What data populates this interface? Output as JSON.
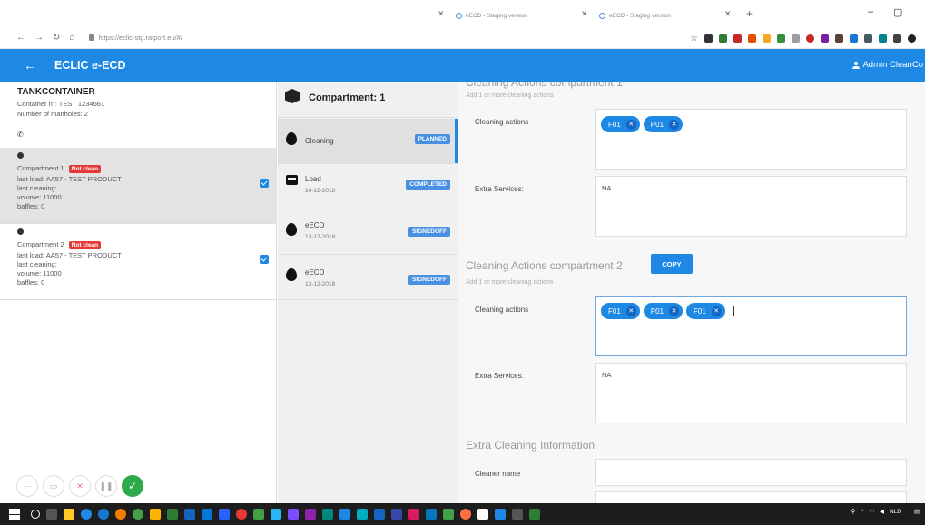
{
  "browser": {
    "tabs": [
      {
        "label": "eECD - Staging version"
      },
      {
        "label": "eECD - Staging version"
      }
    ],
    "url": "https://eclic-stg.ratport.eu/#/"
  },
  "appbar": {
    "title": "ECLIC e-ECD",
    "user": "Admin CleanCo"
  },
  "tank": {
    "title": "TANKCONTAINER",
    "container": "Container n°: TEST 1234561",
    "manholes": "Number of manholes: 2"
  },
  "compartments": [
    {
      "name": "Compartment 1",
      "badge": "Not clean",
      "last_load": "last load: AA57 - TEST PRODUCT",
      "last_cleaning": "last cleaning:",
      "volume": "volume: 11000",
      "baffles": "baffles: 0"
    },
    {
      "name": "Compartment 2",
      "badge": "Not clean",
      "last_load": "last load: AA57 - TEST PRODUCT",
      "last_cleaning": "last cleaning:",
      "volume": "volume: 11000",
      "baffles": "baffles: 0"
    }
  ],
  "middle": {
    "title": "Compartment: 1",
    "steps": [
      {
        "name": "Cleaning",
        "date": "",
        "status": "PLANNED"
      },
      {
        "name": "Load",
        "date": "10-12-2018",
        "status": "COMPLETED"
      },
      {
        "name": "eECD",
        "date": "13-12-2018",
        "status": "SIGNEDOFF"
      },
      {
        "name": "eECD",
        "date": "13-12-2018",
        "status": "SIGNEDOFF"
      }
    ]
  },
  "form": {
    "sec1": {
      "title": "Cleaning Actions compartment 1",
      "subtitle": "Add 1 or more cleaning actions",
      "actions_label": "Cleaning actions",
      "chips": [
        "F01",
        "P01"
      ],
      "services_label": "Extra Services:",
      "services_value": "NA"
    },
    "sec2": {
      "title": "Cleaning Actions compartment 2",
      "copy_label": "COPY",
      "subtitle": "Add 1 or more cleaning actions",
      "actions_label": "Cleaning actions",
      "chips": [
        "F01",
        "P01",
        "F01"
      ],
      "services_label": "Extra Services:",
      "services_value": "NA"
    },
    "extra": {
      "title": "Extra Cleaning Information",
      "cleaner_label": "Cleaner name"
    }
  },
  "tray": {
    "lang": "NLD"
  }
}
